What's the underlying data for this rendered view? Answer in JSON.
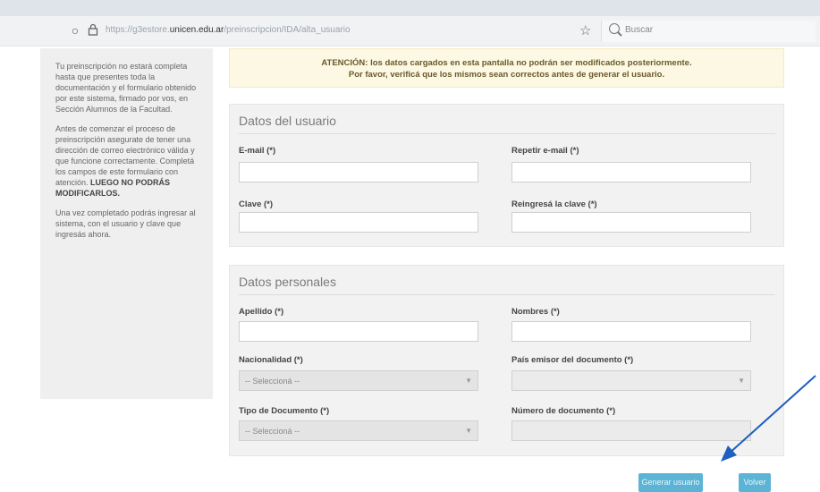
{
  "browser": {
    "url_prefix": "https://g3estore.",
    "url_domain": "unicen.edu.ar",
    "url_path": "/preinscripcion/IDA/alta_usuario",
    "search_placeholder": "Buscar"
  },
  "sidebar": {
    "paragraph1": "Tu preinscripción no estará completa hasta que presentes toda la documentación y el formulario obtenido por este sistema, firmado por vos, en Sección Alumnos de la Facultad.",
    "paragraph2": "Antes de comenzar el proceso de preinscripción asegurate de tener una dirección de correo electrónico válida y que funcione correctamente. Completá los campos de este formulario con atención.",
    "paragraph2_strong": "LUEGO NO PODRÁS MODIFICARLOS.",
    "paragraph3": "Una vez completado podrás ingresar al sistema, con el usuario y clave que ingresás ahora."
  },
  "alert": {
    "line1": "ATENCIÓN: los datos cargados en esta pantalla no podrán ser modificados posteriormente.",
    "line2": "Por favor, verificá que los mismos sean correctos antes de generar el usuario."
  },
  "user_section": {
    "title": "Datos del usuario",
    "email_label": "E-mail (*)",
    "repeat_email_label": "Repetir e-mail (*)",
    "password_label": "Clave (*)",
    "repeat_password_label": "Reingresá la clave (*)"
  },
  "personal_section": {
    "title": "Datos personales",
    "surname_label": "Apellido (*)",
    "names_label": "Nombres (*)",
    "nationality_label": "Nacionalidad (*)",
    "nationality_value": "-- Seleccioná --",
    "issuing_country_label": "País emisor del documento (*)",
    "issuing_country_value": "",
    "doc_type_label": "Tipo de Documento (*)",
    "doc_type_value": "-- Seleccioná --",
    "doc_number_label": "Número de documento (*)"
  },
  "buttons": {
    "generate": "Generar usuario",
    "back": "Volver"
  },
  "colors": {
    "button": "#5bb4d6",
    "alert_bg": "#fcf8e3",
    "arrow": "#1f5fbf"
  }
}
